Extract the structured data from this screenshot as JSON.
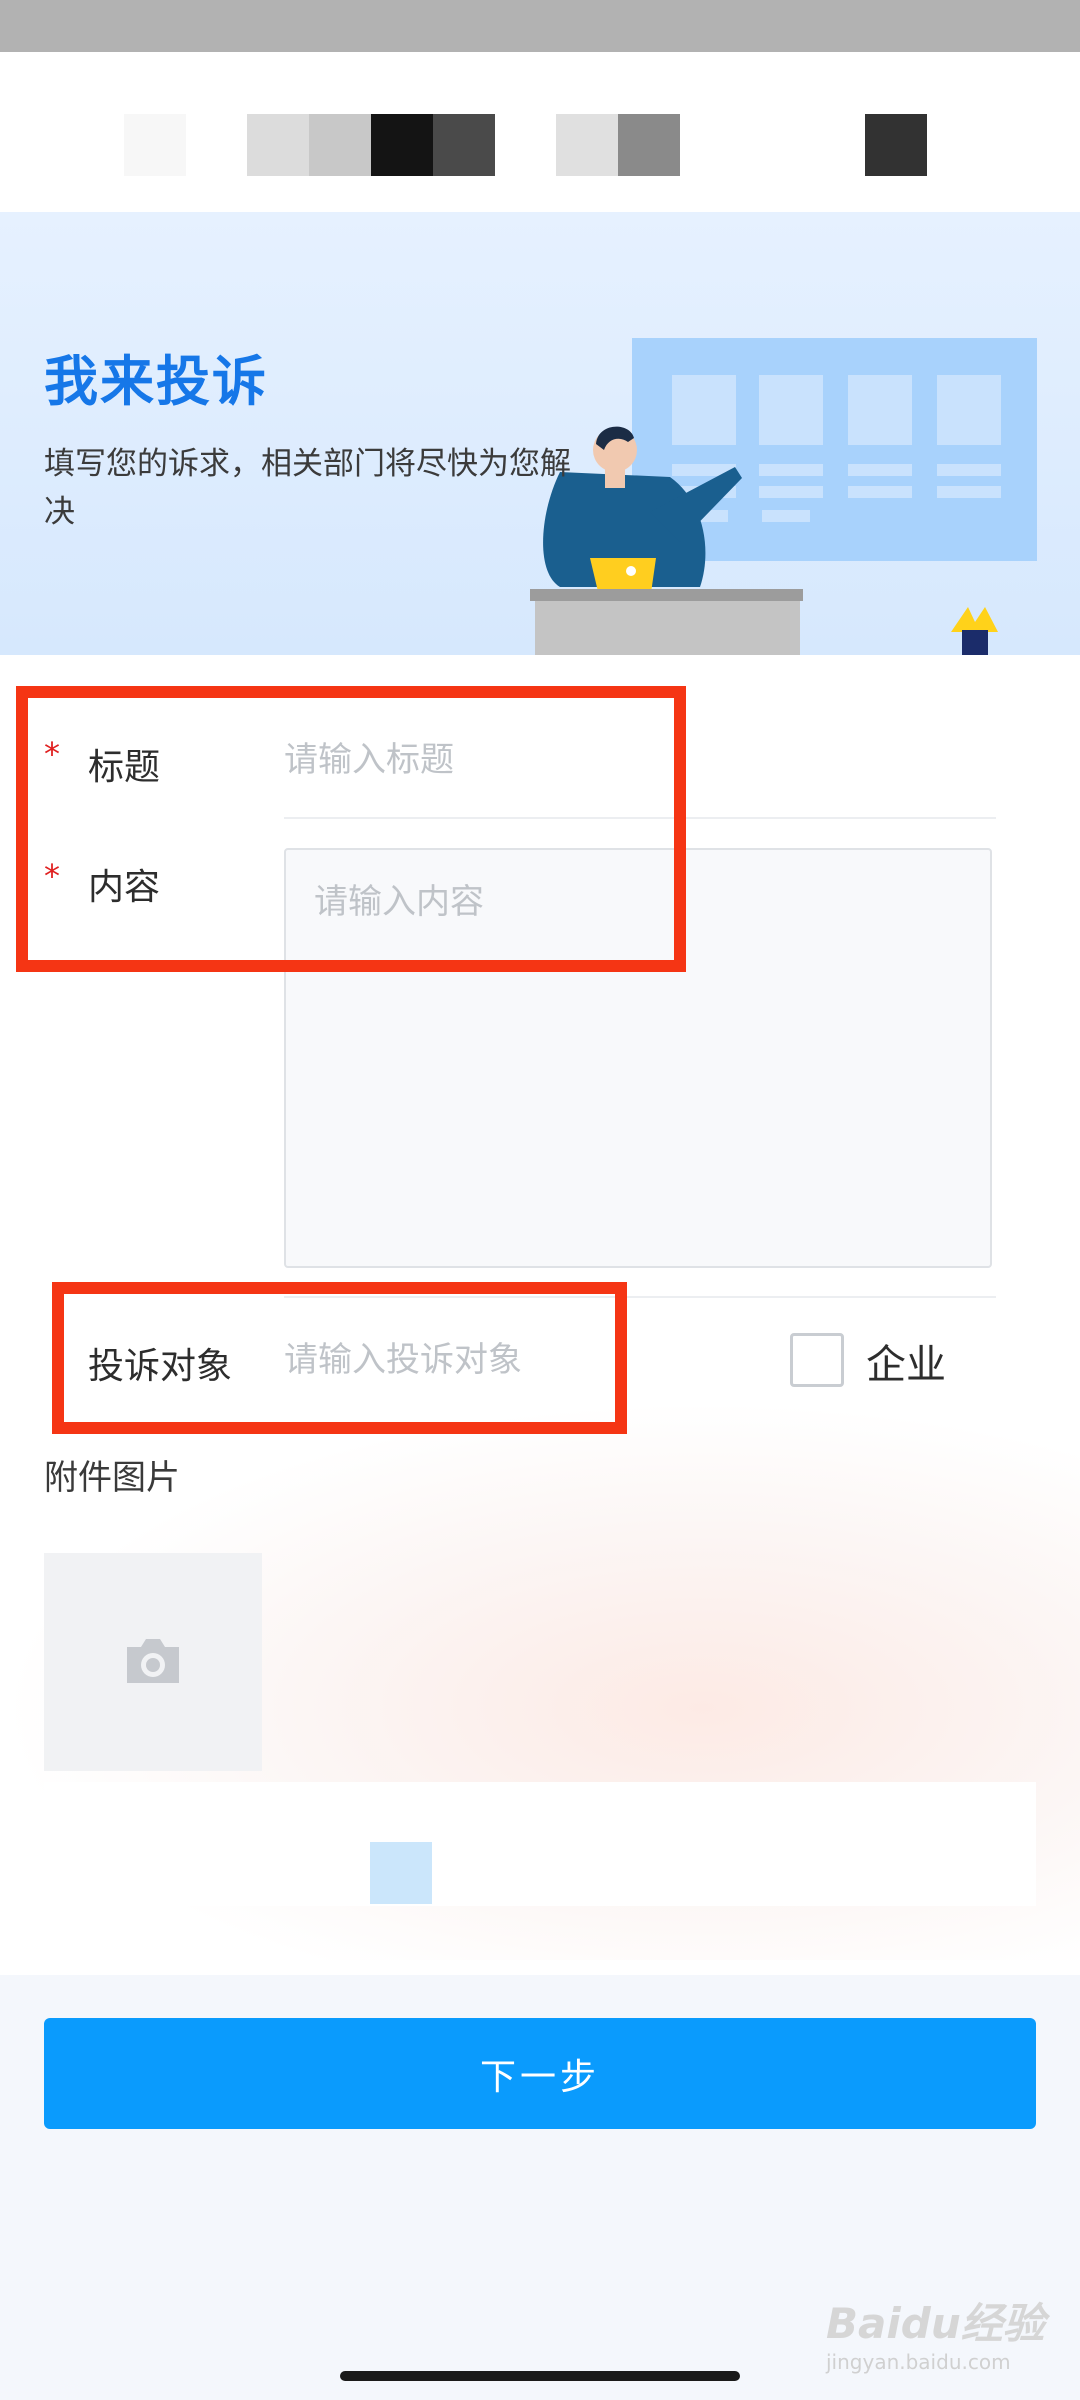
{
  "banner": {
    "title": "我来投诉",
    "subtitle": "填写您的诉求，相关部门将尽快为您解决"
  },
  "form": {
    "title_field": {
      "label": "标题",
      "placeholder": "请输入标题",
      "required": true
    },
    "content_field": {
      "label": "内容",
      "placeholder": "请输入内容",
      "required": true
    },
    "target_field": {
      "label": "投诉对象",
      "placeholder": "请输入投诉对象"
    },
    "enterprise_checkbox": {
      "label": "企业",
      "checked": false
    },
    "attachment": {
      "label": "附件图片"
    }
  },
  "actions": {
    "next_label": "下一步"
  },
  "watermark": {
    "text": "Baidu经验",
    "sub": "jingyan.baidu.com"
  },
  "colors": {
    "accent": "#0a9bfd",
    "title_blue": "#1677e8",
    "highlight_red": "#f53514",
    "required_red": "#e02020"
  },
  "icons": {
    "upload": "camera-icon"
  }
}
